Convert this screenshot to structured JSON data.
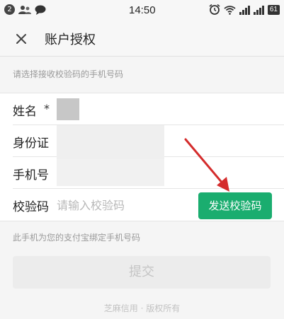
{
  "status_bar": {
    "notification_count": "2",
    "time": "14:50",
    "battery": "61",
    "icons": [
      "people-icon",
      "chat-bubble-icon",
      "alarm-clock-icon",
      "wifi-icon",
      "signal-icon",
      "signal-icon",
      "battery-icon"
    ]
  },
  "nav": {
    "title": "账户授权",
    "close_icon": "close-icon"
  },
  "hint_top": "请选择接收校验码的手机号码",
  "form": {
    "name_label": "姓名",
    "name_value": "*",
    "id_label": "身份证",
    "phone_label": "手机号",
    "code_label": "校验码",
    "code_placeholder": "请输入校验码",
    "send_button": "发送校验码"
  },
  "hint_bottom": "此手机为您的支付宝绑定手机号码",
  "submit_button": "提交",
  "footer": "芝麻信用 · 版权所有",
  "colors": {
    "accent": "#1aad6f",
    "annotation_arrow": "#d42c2c"
  }
}
